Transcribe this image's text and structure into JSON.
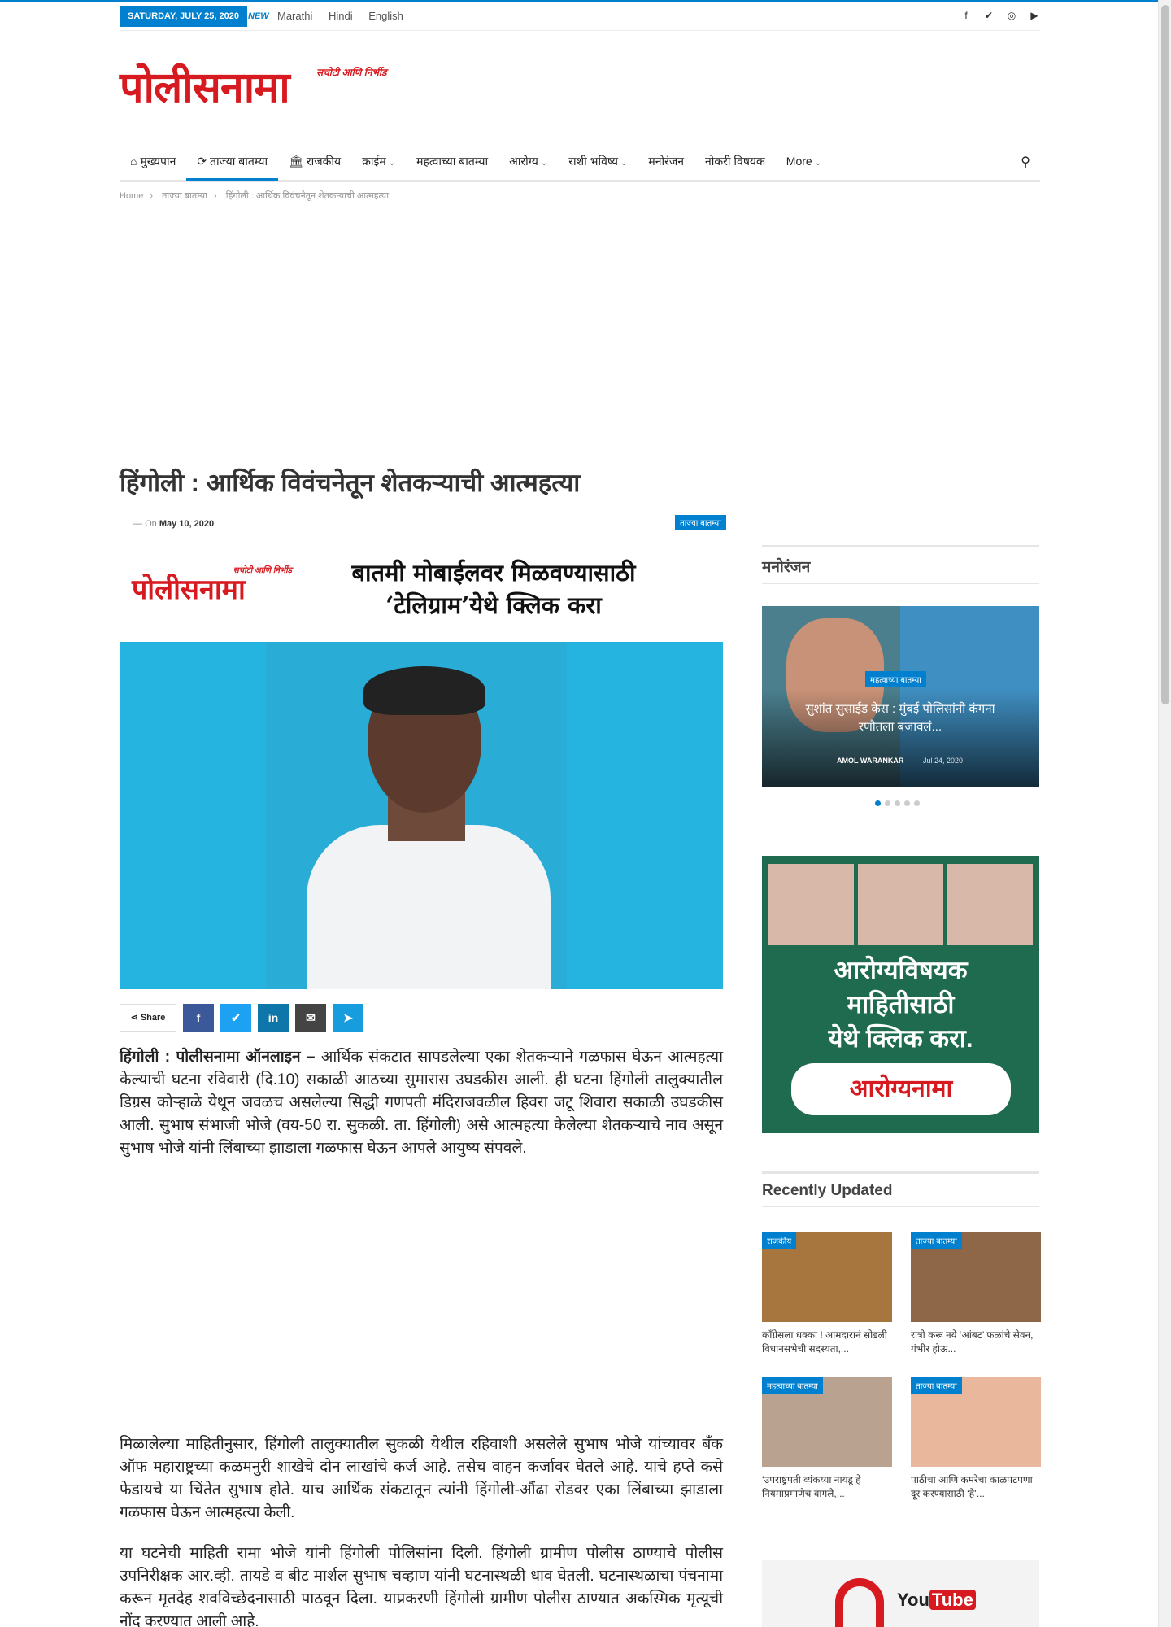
{
  "topbar": {
    "date": "SATURDAY, JULY 25, 2020",
    "new_badge": "NEW",
    "languages": [
      "Marathi",
      "Hindi",
      "English"
    ],
    "social_icons": [
      "facebook-icon",
      "twitter-icon",
      "instagram-icon",
      "youtube-icon"
    ]
  },
  "logo": {
    "name": "पोलीसनामा",
    "tagline": "सचोटी आणि निर्भीड"
  },
  "nav": {
    "items": [
      {
        "label": "मुख्यपान",
        "icon": "home-icon"
      },
      {
        "label": "ताज्या बातम्या",
        "icon": "refresh-icon"
      },
      {
        "label": "राजकीय",
        "icon": "bank-icon"
      },
      {
        "label": "क्राईम",
        "dropdown": true
      },
      {
        "label": "महत्वाच्या बातम्या"
      },
      {
        "label": "आरोग्य",
        "dropdown": true
      },
      {
        "label": "राशी भविष्य",
        "dropdown": true
      },
      {
        "label": "मनोरंजन"
      },
      {
        "label": "नोकरी विषयक"
      },
      {
        "label": "More",
        "dropdown": true
      }
    ]
  },
  "breadcrumb": [
    "Home",
    "ताज्या बातम्या",
    "हिंगोली : आर्थिक विवंचनेतून शेतकऱ्याची आत्महत्या"
  ],
  "article": {
    "title": "हिंगोली : आर्थिक विवंचनेतून शेतकऱ्याची आत्महत्या",
    "on_label": "On",
    "date": "May 10, 2020",
    "category": "ताज्या बातम्या",
    "promo_logo": "पोलीसनामा",
    "promo_tagline": "सचोटी आणि निर्भीड",
    "promo_line1": "बातमी मोबाईलवर मिळवण्यासाठी",
    "promo_line2": "‘टेलिग्राम’येथे क्लिक करा",
    "share_label": "Share",
    "lead": "हिंगोली : पोलीसनामा ऑनलाइन –",
    "para1": " आर्थिक संकटात सापडलेल्या एका शेतकऱ्याने गळफास घेऊन आत्महत्या केल्याची घटना रविवारी (दि.10) सकाळी आठच्या सुमारास उघडकीस आली. ही घटना हिंगोली तालुक्यातील डिग्रस कोऱ्हाळे येथून जवळच असलेल्या सिद्धी गणपती मंदिराजवळील हिवरा जटू शिवारा सकाळी उघडकीस आली. सुभाष संभाजी भोजे (वय-50 रा. सुकळी. ता. हिंगोली) असे आत्महत्या केलेल्या शेतकऱ्याचे नाव असून सुभाष भोजे यांनी लिंबाच्या झाडाला गळफास घेऊन आपले आयुष्य संपवले.",
    "para2": "मिळालेल्या माहितीनुसार, हिंगोली तालुक्यातील सुकळी येथील रहिवाशी असलेले सुभाष भोजे यांच्यावर बँक ऑफ महाराष्ट्रच्या कळमनुरी शाखेचे दोन लाखांचे कर्ज आहे. तसेच वाहन कर्जावर घेतले आहे. याचे हप्ते कसे फेडायचे या चिंतेत सुभाष होते. याच आर्थिक संकटातून त्यांनी हिंगोली-औंढा रोडवर एका लिंबाच्या झाडाला गळफास घेऊन आत्महत्या केली.",
    "para3": "या घटनेची माहिती रामा भोजे यांनी हिंगोली पोलिसांना दिली. हिंगोली ग्रामीण पोलीस ठाण्याचे पोलीस उपनिरीक्षक आर.व्ही. तायडे व बीट मार्शल सुभाष चव्हाण यांनी घटनास्थळी धाव घेतली. घटनास्थळाचा पंचनामा करून मृतदेह शवविच्छेदनासाठी पाठवून दिला. याप्रकरणी हिंगोली ग्रामीण पोलीस ठाण्यात अकस्मिक मृत्यूची नोंद करण्यात आली आहे."
  },
  "sidebar": {
    "section1_title": "मनोरंजन",
    "slide": {
      "category": "महत्वाच्या बातम्या",
      "title": "सुशांत सुसाईड केस : मुंबई पोलिसांनी कंगना रणौतला बजावलं...",
      "author": "AMOL WARANKAR",
      "date": "Jul 24, 2020"
    },
    "ad_text": [
      "आरोग्यविषयक",
      "माहितीसाठी",
      "येथे क्लिक करा."
    ],
    "ad_button": "आरोग्यनामा",
    "section2_title": "Recently Updated",
    "cards": [
      {
        "category": "राजकीय",
        "title": "काँग्रेसला धक्‍का ! आमदारानं सोडली विधानसभेची सदस्यता,..."
      },
      {
        "category": "ताज्या बातम्या",
        "title": "रात्री करू नये ‘आंबट’ फळांचे सेवन, गंभीर होऊ..."
      },
      {
        "category": "महत्वाच्या बातम्या",
        "title": "‘उपराष्ट्रपती व्यंकय्या नायडू हे नियमाप्रमाणेच वागले,..."
      },
      {
        "category": "ताज्या बातम्या",
        "title": "पाठीचा आणि कमरेचा काळपटपणा दूर करण्यासाठी ‘हे’..."
      }
    ],
    "youtube_label": "You",
    "youtube_tube": "Tube"
  },
  "colors": {
    "accent": "#0080ce",
    "brand_red": "#d71920"
  }
}
